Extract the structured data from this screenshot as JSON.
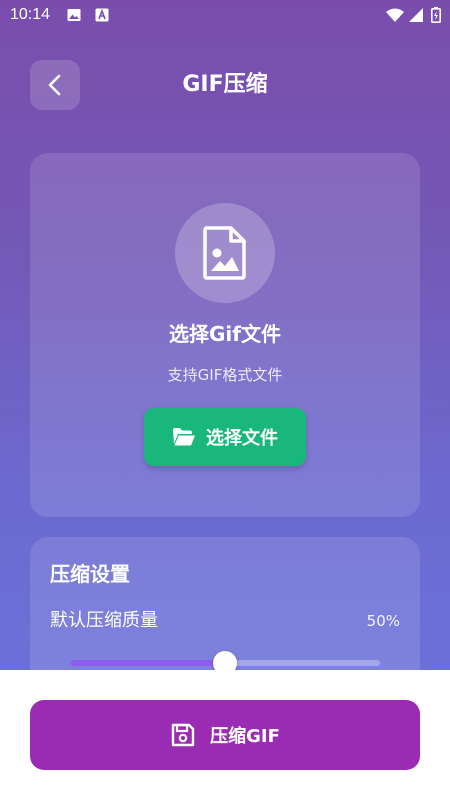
{
  "status_bar": {
    "time": "10:14",
    "icons": [
      "image-icon",
      "a-box-icon",
      "wifi-icon",
      "signal-icon",
      "battery-charging-icon"
    ]
  },
  "header": {
    "title": "GIF压缩",
    "back_icon": "chevron-left-icon"
  },
  "file_card": {
    "icon": "image-file-icon",
    "title": "选择Gif文件",
    "subtitle": "支持GIF格式文件",
    "button": {
      "label": "选择文件",
      "icon": "folder-open-icon"
    }
  },
  "settings": {
    "title": "压缩设置",
    "quality_label": "默认压缩质量",
    "quality_value": "50%",
    "quality_fraction": 0.5
  },
  "bottom": {
    "compress_button_label": "压缩GIF",
    "compress_icon": "save-icon"
  },
  "colors": {
    "gradient_top": "#7a4dad",
    "gradient_bottom": "#6a76df",
    "primary_green": "#19b77b",
    "compress_purple": "#9a2cb3",
    "slider_fill": "#8e5cf0"
  }
}
